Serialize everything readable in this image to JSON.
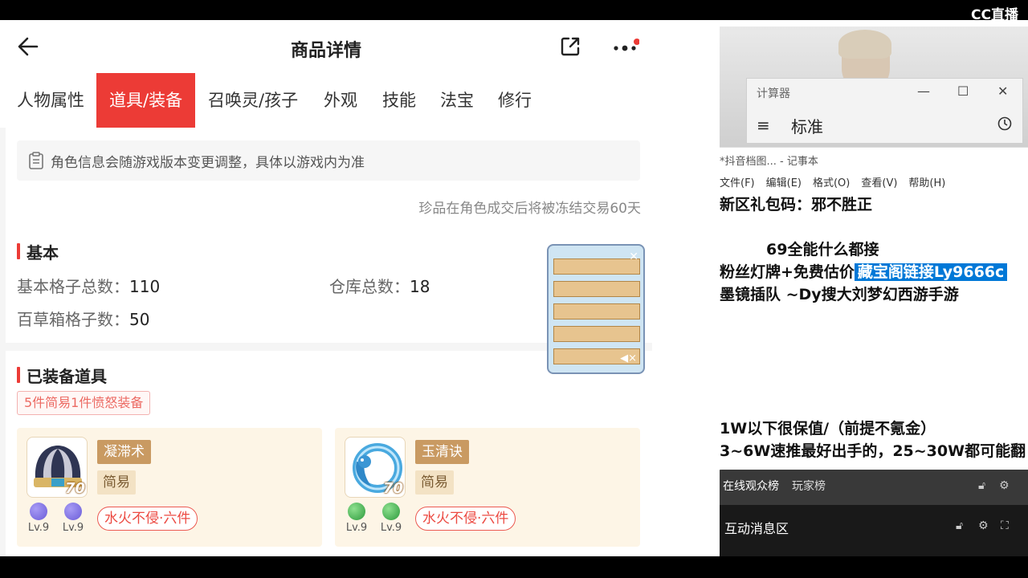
{
  "app": {
    "title": "商品详情",
    "tabs": [
      "人物属性",
      "道具/装备",
      "召唤灵/孩子",
      "外观",
      "技能",
      "法宝",
      "修行"
    ],
    "active_tab": 1,
    "notice": "角色信息会随游戏版本变更调整，具体以游戏内为准",
    "frozen_note": "珍品在角色成交后将被冻结交易60天",
    "basic": {
      "title": "基本",
      "total_slots_label": "基本格子总数：",
      "total_slots_value": "110",
      "warehouse_label": "仓库总数：",
      "warehouse_value": "18",
      "herb_label": "百草箱格子数：",
      "herb_value": "50"
    },
    "equipped": {
      "title": "已装备道具",
      "summary_tag": "5件简易1件愤怒装备",
      "items": [
        {
          "level_badge": "70",
          "skill": "凝滞术",
          "type": "简易",
          "gems": [
            {
              "color": "#6a5cd8",
              "lv": "Lv.9"
            },
            {
              "color": "#6a5cd8",
              "lv": "Lv.9"
            }
          ],
          "set": "水火不侵·六件"
        },
        {
          "level_badge": "70",
          "skill": "玉清诀",
          "type": "简易",
          "gems": [
            {
              "color": "#3aa84a",
              "lv": "Lv.9"
            },
            {
              "color": "#3aa84a",
              "lv": "Lv.9"
            }
          ],
          "set": "水火不侵·六件"
        }
      ]
    }
  },
  "stream": {
    "logo": "CC直播",
    "calculator": {
      "title": "计算器",
      "mode": "标准",
      "minimize": "—",
      "maximize": "☐",
      "close": "✕"
    },
    "notepad": {
      "title": "*抖音档图... - 记事本",
      "menu": [
        "文件(F)",
        "编辑(E)",
        "格式(O)",
        "查看(V)",
        "帮助(H)"
      ],
      "lines": [
        "新区礼包码：邪不胜正",
        "69全能什么都接",
        "粉丝灯牌+免费估价",
        "墨镜插队 ~Dy搜大刘梦幻西游手游",
        "1W以下很保值/（前提不氪金）",
        "3~6W速推最好出手的，25~30W都可能翻"
      ],
      "highlight": "藏宝阁链接Ly9666c"
    },
    "chat": {
      "tabs": [
        "在线观众榜",
        "玩家榜"
      ],
      "section": "互动消息区"
    }
  }
}
